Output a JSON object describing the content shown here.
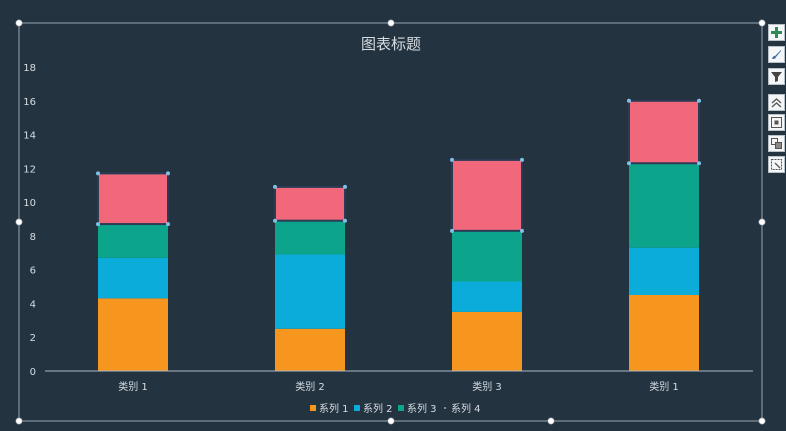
{
  "chart_data": {
    "type": "bar",
    "stacked": true,
    "title": "图表标题",
    "categories": [
      "类别 1",
      "类别 2",
      "类别 3",
      "类别 1"
    ],
    "series": [
      {
        "name": "系列 1",
        "color": "#F7961E",
        "values": [
          4.3,
          2.5,
          3.5,
          4.5
        ]
      },
      {
        "name": "系列 2",
        "color": "#0BACD9",
        "values": [
          2.4,
          4.4,
          1.8,
          2.8
        ]
      },
      {
        "name": "系列 3",
        "color": "#0CA58C",
        "values": [
          2.0,
          2.0,
          3.0,
          5.0
        ]
      },
      {
        "name": "系列 4",
        "color": "#F0687A",
        "values": [
          3.0,
          2.0,
          4.2,
          3.7
        ]
      }
    ],
    "ylim": [
      0,
      18
    ],
    "yticks": [
      0,
      2,
      4,
      6,
      8,
      10,
      12,
      14,
      16,
      18
    ],
    "grid": false,
    "legend": "bottom",
    "selected_series": "系列 4"
  },
  "style": {
    "background": "#233340",
    "text_color": "#D6DDE3",
    "axis_color": "#AEB9C3",
    "selection_color": "#7FC1E6",
    "frame_color": "#9AA7B3"
  },
  "toolbar": {
    "icons": [
      {
        "name": "chart-elements-plus-icon"
      },
      {
        "name": "chart-styles-brush-icon"
      },
      {
        "name": "chart-filters-funnel-icon"
      },
      {
        "name": "bring-forward-icon"
      },
      {
        "name": "group-objects-icon"
      },
      {
        "name": "arrange-layers-icon"
      },
      {
        "name": "crop-select-icon"
      }
    ]
  }
}
